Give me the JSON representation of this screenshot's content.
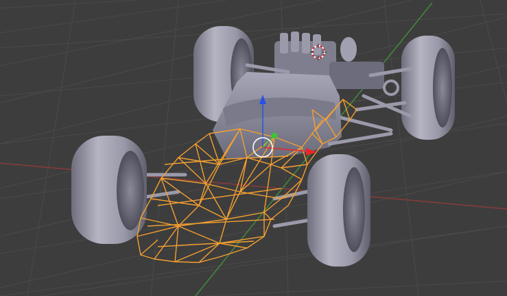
{
  "viewport": {
    "background": "#3d3d3d",
    "grid_line_color": "#4a4a4a",
    "x_axis_color": "#8a3a3a",
    "y_axis_color": "#3f8c3a",
    "selection_wire_color": "#f5a030",
    "mesh_base_color": "#9a9aab",
    "mesh_shadow_color": "#5e5e6c",
    "gizmo_x_color": "#e8262a",
    "gizmo_y_color": "#3fc23a",
    "gizmo_z_color": "#2a50e8",
    "pivot_color": "#ffffff",
    "cursor_ring_red": "#e02020",
    "cursor_ring_white": "#ffffff"
  },
  "scene": {
    "object_name_icon": "race-car-mesh",
    "selected_part": "nose-cone-wireframe",
    "gizmo": "translate-gizmo",
    "cursor": "3d-cursor"
  }
}
